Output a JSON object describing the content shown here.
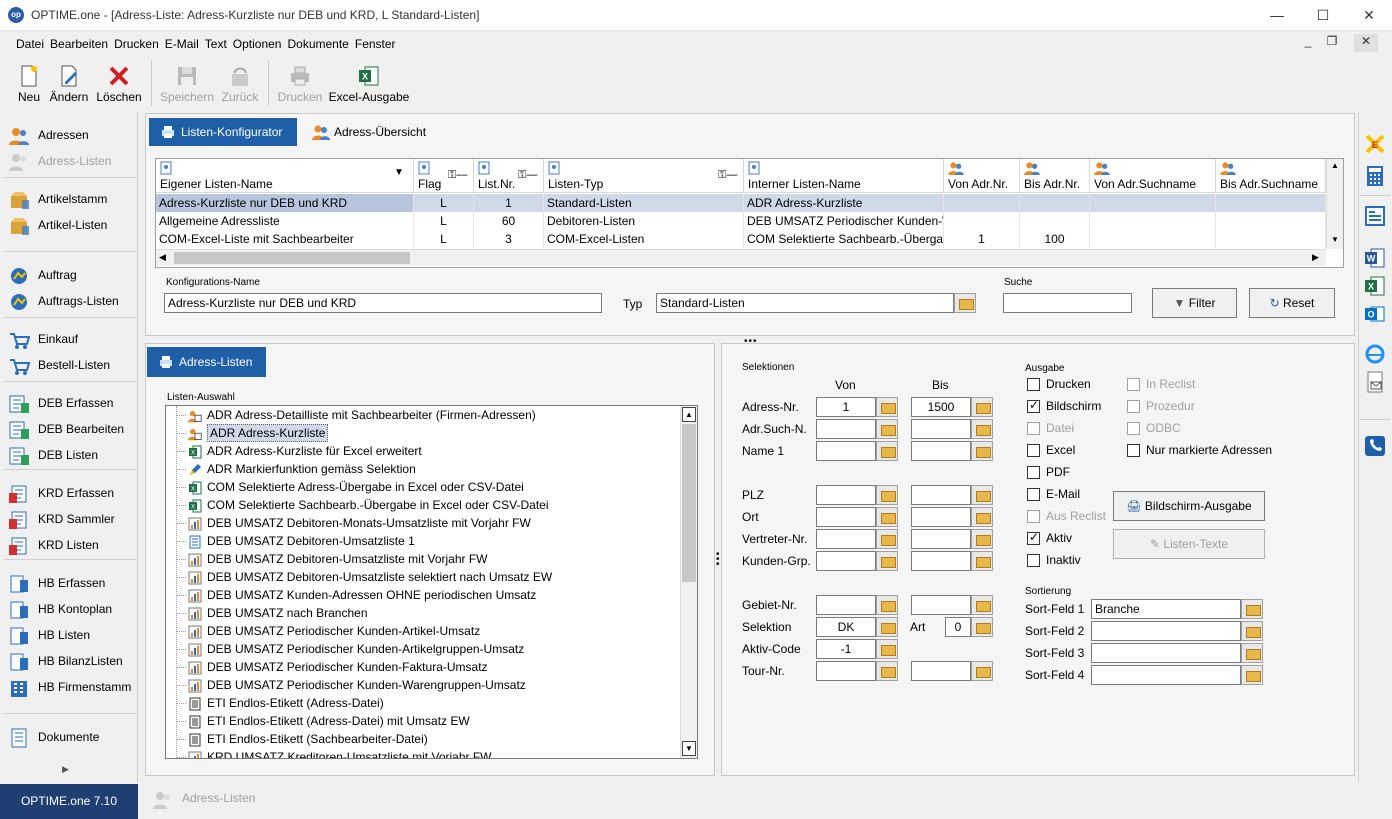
{
  "window": {
    "app_name": "OPTIME.one",
    "title": "[Adress-Liste: Adress-Kurzliste nur DEB und KRD, L Standard-Listen]",
    "logo_text": "op"
  },
  "menu": [
    "Datei",
    "Bearbeiten",
    "Drucken",
    "E-Mail",
    "Text",
    "Optionen",
    "Dokumente",
    "Fenster"
  ],
  "toolbar": {
    "new": "Neu",
    "edit": "Ändern",
    "delete": "Löschen",
    "save": "Speichern",
    "back": "Zurück",
    "print": "Drucken",
    "excel": "Excel-Ausgabe"
  },
  "sidebar": [
    {
      "label": "Adressen",
      "icon": "people-icon",
      "enabled": true
    },
    {
      "label": "Adress-Listen",
      "icon": "people-list-icon",
      "enabled": false
    },
    {
      "label": "Artikelstamm",
      "icon": "box-icon",
      "enabled": true
    },
    {
      "label": "Artikel-Listen",
      "icon": "box-list-icon",
      "enabled": true
    },
    {
      "label": "Auftrag",
      "icon": "order-icon",
      "enabled": true
    },
    {
      "label": "Auftrags-Listen",
      "icon": "order-list-icon",
      "enabled": true
    },
    {
      "label": "Einkauf",
      "icon": "cart-icon",
      "enabled": true
    },
    {
      "label": "Bestell-Listen",
      "icon": "cart-list-icon",
      "enabled": true
    },
    {
      "label": "DEB Erfassen",
      "icon": "deb-add-icon",
      "enabled": true
    },
    {
      "label": "DEB Bearbeiten",
      "icon": "deb-edit-icon",
      "enabled": true
    },
    {
      "label": "DEB Listen",
      "icon": "deb-list-icon",
      "enabled": true
    },
    {
      "label": "KRD Erfassen",
      "icon": "krd-add-icon",
      "enabled": true
    },
    {
      "label": "KRD Sammler",
      "icon": "krd-collect-icon",
      "enabled": true
    },
    {
      "label": "KRD Listen",
      "icon": "krd-list-icon",
      "enabled": true
    },
    {
      "label": "HB Erfassen",
      "icon": "hb-add-icon",
      "enabled": true
    },
    {
      "label": "HB Kontoplan",
      "icon": "hb-plan-icon",
      "enabled": true
    },
    {
      "label": "HB Listen",
      "icon": "hb-list-icon",
      "enabled": true
    },
    {
      "label": "HB BilanzListen",
      "icon": "hb-balance-icon",
      "enabled": true
    },
    {
      "label": "HB Firmenstamm",
      "icon": "building-icon",
      "enabled": true
    },
    {
      "label": "Dokumente",
      "icon": "document-icon",
      "enabled": true
    }
  ],
  "status": {
    "version": "OPTIME.one  7.10",
    "tab": "Adress-Listen"
  },
  "tabs_top": {
    "active": "Listen-Konfigurator",
    "other": "Adress-Übersicht"
  },
  "grid": {
    "headers": [
      "Eigener Listen-Name",
      "Flag",
      "List.Nr.",
      "Listen-Typ",
      "Interner Listen-Name",
      "Von Adr.Nr.",
      "Bis Adr.Nr.",
      "Von Adr.Suchname",
      "Bis Adr.Suchname"
    ],
    "rows": [
      [
        "Adress-Kurzliste nur DEB und KRD",
        "L",
        "1",
        "Standard-Listen",
        "ADR Adress-Kurzliste",
        "",
        "",
        "",
        ""
      ],
      [
        "Allgemeine Adressliste",
        "L",
        "60",
        "Debitoren-Listen",
        "DEB UMSATZ Periodischer Kunden-W",
        "",
        "",
        "",
        ""
      ],
      [
        "COM-Excel-Liste mit Sachbearbeiter",
        "L",
        "3",
        "COM-Excel-Listen",
        "COM Selektierte Sachbearb.-Übergab",
        "1",
        "100",
        "",
        ""
      ]
    ]
  },
  "config": {
    "name_label": "Konfigurations-Name",
    "name_value": "Adress-Kurzliste nur DEB und KRD",
    "typ_label": "Typ",
    "typ_value": "Standard-Listen",
    "search_label": "Suche",
    "search_value": "",
    "filter": "Filter",
    "reset": "Reset"
  },
  "list_panel": {
    "tab": "Adress-Listen",
    "group_label": "Listen-Auswahl",
    "selected": 1,
    "items": [
      {
        "text": "ADR Adress-Detailliste mit Sachbearbeiter (Firmen-Adressen)",
        "icon": "people-icon"
      },
      {
        "text": "ADR Adress-Kurzliste",
        "icon": "people-icon"
      },
      {
        "text": "ADR Adress-Kurzliste für Excel erweitert",
        "icon": "excel-icon"
      },
      {
        "text": "ADR Markierfunktion gemäss Selektion",
        "icon": "pencil-icon"
      },
      {
        "text": "COM Selektierte Adress-Übergabe in Excel oder CSV-Datei",
        "icon": "excel-icon"
      },
      {
        "text": "COM Selektierte Sachbearb.-Übergabe in Excel oder CSV-Datei",
        "icon": "excel-icon"
      },
      {
        "text": "DEB UMSATZ Debitoren-Monats-Umsatzliste mit Vorjahr FW",
        "icon": "chart-icon"
      },
      {
        "text": "DEB UMSATZ Debitoren-Umsatzliste 1",
        "icon": "doc-icon"
      },
      {
        "text": "DEB UMSATZ Debitoren-Umsatzliste mit Vorjahr FW",
        "icon": "chart-icon"
      },
      {
        "text": "DEB UMSATZ Debitoren-Umsatzliste selektiert nach Umsatz EW",
        "icon": "chart-icon"
      },
      {
        "text": "DEB UMSATZ Kunden-Adressen OHNE periodischen Umsatz",
        "icon": "chart-icon"
      },
      {
        "text": "DEB UMSATZ nach Branchen",
        "icon": "chart-icon"
      },
      {
        "text": "DEB UMSATZ Periodischer Kunden-Artikel-Umsatz",
        "icon": "chart-icon"
      },
      {
        "text": "DEB UMSATZ Periodischer Kunden-Artikelgruppen-Umsatz",
        "icon": "chart-icon"
      },
      {
        "text": "DEB UMSATZ Periodischer Kunden-Faktura-Umsatz",
        "icon": "chart-icon"
      },
      {
        "text": "DEB UMSATZ Periodischer Kunden-Warengruppen-Umsatz",
        "icon": "chart-icon"
      },
      {
        "text": "ETI Endlos-Etikett (Adress-Datei)",
        "icon": "label-icon"
      },
      {
        "text": "ETI Endlos-Etikett (Adress-Datei) mit Umsatz EW",
        "icon": "label-icon"
      },
      {
        "text": "ETI Endlos-Etikett (Sachbearbeiter-Datei)",
        "icon": "label-icon"
      },
      {
        "text": "KRD UMSATZ Kreditoren-Umsatzliste mit Vorjahr FW",
        "icon": "chart-icon"
      }
    ]
  },
  "selections": {
    "group_label": "Selektionen",
    "von": "Von",
    "bis": "Bis",
    "rows": [
      {
        "label": "Adress-Nr.",
        "von": "1",
        "bis": "1500"
      },
      {
        "label": "Adr.Such-N.",
        "von": "",
        "bis": ""
      },
      {
        "label": "Name 1",
        "von": "",
        "bis": ""
      },
      {
        "label": "PLZ",
        "von": "",
        "bis": ""
      },
      {
        "label": "Ort",
        "von": "",
        "bis": ""
      },
      {
        "label": "Vertreter-Nr.",
        "von": "",
        "bis": ""
      },
      {
        "label": "Kunden-Grp.",
        "von": "",
        "bis": ""
      },
      {
        "label": "Gebiet-Nr.",
        "von": "",
        "bis": ""
      },
      {
        "label": "Selektion",
        "von": "DK",
        "bis": ""
      },
      {
        "label": "Aktiv-Code",
        "von": "-1",
        "bis": ""
      },
      {
        "label": "Tour-Nr.",
        "von": "",
        "bis": ""
      }
    ],
    "art_label": "Art",
    "art_value": "0"
  },
  "output": {
    "group_label": "Ausgabe",
    "left": [
      {
        "label": "Drucken",
        "checked": false,
        "enabled": true
      },
      {
        "label": "Bildschirm",
        "checked": true,
        "enabled": true
      },
      {
        "label": "Datei",
        "checked": false,
        "enabled": false
      },
      {
        "label": "Excel",
        "checked": false,
        "enabled": true
      },
      {
        "label": "PDF",
        "checked": false,
        "enabled": true
      },
      {
        "label": "E-Mail",
        "checked": false,
        "enabled": true
      },
      {
        "label": "Aus Reclist",
        "checked": false,
        "enabled": false
      },
      {
        "label": "Aktiv",
        "checked": true,
        "enabled": true
      },
      {
        "label": "Inaktiv",
        "checked": false,
        "enabled": true
      }
    ],
    "right": [
      {
        "label": "In Reclist",
        "checked": false,
        "enabled": false
      },
      {
        "label": "Prozedur",
        "checked": false,
        "enabled": false
      },
      {
        "label": "ODBC",
        "checked": false,
        "enabled": false
      },
      {
        "label": "Nur markierte Adressen",
        "checked": false,
        "enabled": true
      }
    ],
    "screen_btn": "Bildschirm-Ausgabe",
    "texts_btn": "Listen-Texte"
  },
  "sort": {
    "group_label": "Sortierung",
    "rows": [
      {
        "label": "Sort-Feld 1",
        "value": "Branche"
      },
      {
        "label": "Sort-Feld 2",
        "value": ""
      },
      {
        "label": "Sort-Feld 3",
        "value": ""
      },
      {
        "label": "Sort-Feld 4",
        "value": ""
      }
    ]
  }
}
